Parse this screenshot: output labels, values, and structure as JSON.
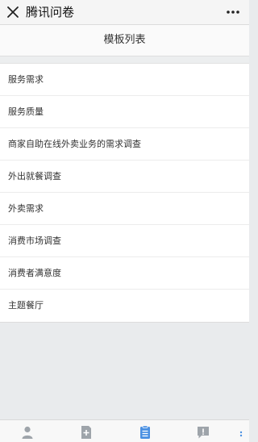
{
  "topbar": {
    "title": "腾讯问卷",
    "close_icon": "close-icon",
    "more_icon": "more-icon"
  },
  "subheader": {
    "title": "模板列表"
  },
  "templates": [
    "服务需求",
    "服务质量",
    "商家自助在线外卖业务的需求调查",
    "外出就餐调查",
    "外卖需求",
    "消费市场调查",
    "消费者满意度",
    "主题餐厅"
  ],
  "tabbar": {
    "tabs": [
      "user-icon",
      "add-document-icon",
      "list-document-icon",
      "notice-icon",
      "more-icon"
    ],
    "active_index": 2,
    "active_color": "#4a90e2",
    "inactive_color": "#9ea4aa"
  }
}
